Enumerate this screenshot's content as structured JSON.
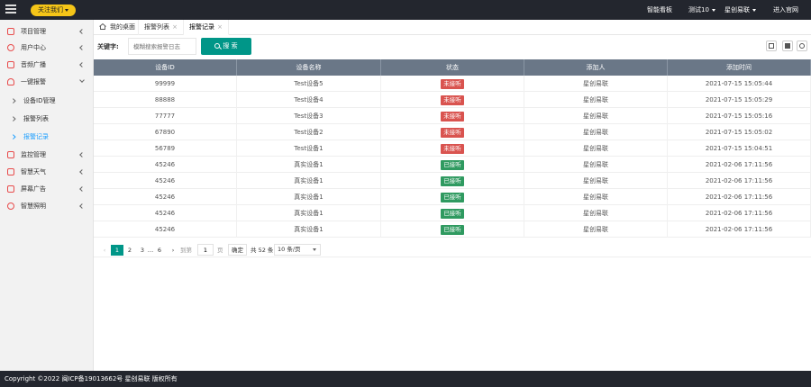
{
  "topbar": {
    "follow_label": "关注我们",
    "nav": [
      {
        "label": "智能看板",
        "caret": false
      },
      {
        "label": "测试10",
        "caret": true
      },
      {
        "label": "星创易联",
        "caret": true
      },
      {
        "label": "进入官网",
        "caret": false
      }
    ]
  },
  "sidebar": {
    "items": [
      {
        "label": "项目管理",
        "icon": "project-icon"
      },
      {
        "label": "用户中心",
        "icon": "user-icon"
      },
      {
        "label": "音频广播",
        "icon": "audio-icon"
      },
      {
        "label": "一键报警",
        "icon": "alarm-icon",
        "expanded": true
      },
      {
        "label": "监控管理",
        "icon": "camera-icon"
      },
      {
        "label": "智慧天气",
        "icon": "weather-icon"
      },
      {
        "label": "屏幕广告",
        "icon": "screen-icon"
      },
      {
        "label": "智慧照明",
        "icon": "bulb-icon"
      }
    ],
    "subitems": [
      {
        "label": "设备ID管理",
        "active": false
      },
      {
        "label": "报警列表",
        "active": false
      },
      {
        "label": "报警记录",
        "active": true
      }
    ]
  },
  "tabs": [
    {
      "label": "我的桌面",
      "closable": false,
      "home": true
    },
    {
      "label": "报警列表",
      "closable": true
    },
    {
      "label": "报警记录",
      "closable": true,
      "active": true
    }
  ],
  "toolbar": {
    "keyword_label": "关键字:",
    "search_placeholder": "模糊搜索报警日志",
    "search_button": "搜 索"
  },
  "table": {
    "headers": [
      "设备ID",
      "设备名称",
      "状态",
      "添加人",
      "添加时间"
    ],
    "rows": [
      {
        "id": "99999",
        "name": "Test设备5",
        "status": "未接听",
        "status_color": "#d9534f",
        "adder": "星创易联",
        "time": "2021-07-15 15:05:44"
      },
      {
        "id": "88888",
        "name": "Test设备4",
        "status": "未接听",
        "status_color": "#d9534f",
        "adder": "星创易联",
        "time": "2021-07-15 15:05:29"
      },
      {
        "id": "77777",
        "name": "Test设备3",
        "status": "未接听",
        "status_color": "#d9534f",
        "adder": "星创易联",
        "time": "2021-07-15 15:05:16"
      },
      {
        "id": "67890",
        "name": "Test设备2",
        "status": "未接听",
        "status_color": "#d9534f",
        "adder": "星创易联",
        "time": "2021-07-15 15:05:02"
      },
      {
        "id": "56789",
        "name": "Test设备1",
        "status": "未接听",
        "status_color": "#d9534f",
        "adder": "星创易联",
        "time": "2021-07-15 15:04:51"
      },
      {
        "id": "45246",
        "name": "真实设备1",
        "status": "已接听",
        "status_color": "#2f9a60",
        "adder": "星创易联",
        "time": "2021-02-06 17:11:56"
      },
      {
        "id": "45246",
        "name": "真实设备1",
        "status": "已接听",
        "status_color": "#2f9a60",
        "adder": "星创易联",
        "time": "2021-02-06 17:11:56"
      },
      {
        "id": "45246",
        "name": "真实设备1",
        "status": "已接听",
        "status_color": "#2f9a60",
        "adder": "星创易联",
        "time": "2021-02-06 17:11:56"
      },
      {
        "id": "45246",
        "name": "真实设备1",
        "status": "已接听",
        "status_color": "#2f9a60",
        "adder": "星创易联",
        "time": "2021-02-06 17:11:56"
      },
      {
        "id": "45246",
        "name": "真实设备1",
        "status": "已接听",
        "status_color": "#2f9a60",
        "adder": "星创易联",
        "time": "2021-02-06 17:11:56"
      }
    ]
  },
  "pager": {
    "prev": "‹",
    "pages": [
      "1",
      "2",
      "3"
    ],
    "ellipsis": "…",
    "last_page": "6",
    "next": "›",
    "goto_label": "到第",
    "goto_value": "1",
    "page_unit": "页",
    "confirm": "确定",
    "total": "共 52 条",
    "page_size": "10 条/页"
  },
  "footer": {
    "copyright": "Copyright ©2022 闽ICP备19013662号 星创易联 版权所有"
  },
  "colors": {
    "topbar_bg": "#23262e",
    "accent": "#009688",
    "follow_btn": "#f5c518",
    "active_link": "#1e9fff",
    "header_bg": "#6a7787",
    "status_unanswered": "#d9534f",
    "status_answered": "#2f9a60"
  }
}
